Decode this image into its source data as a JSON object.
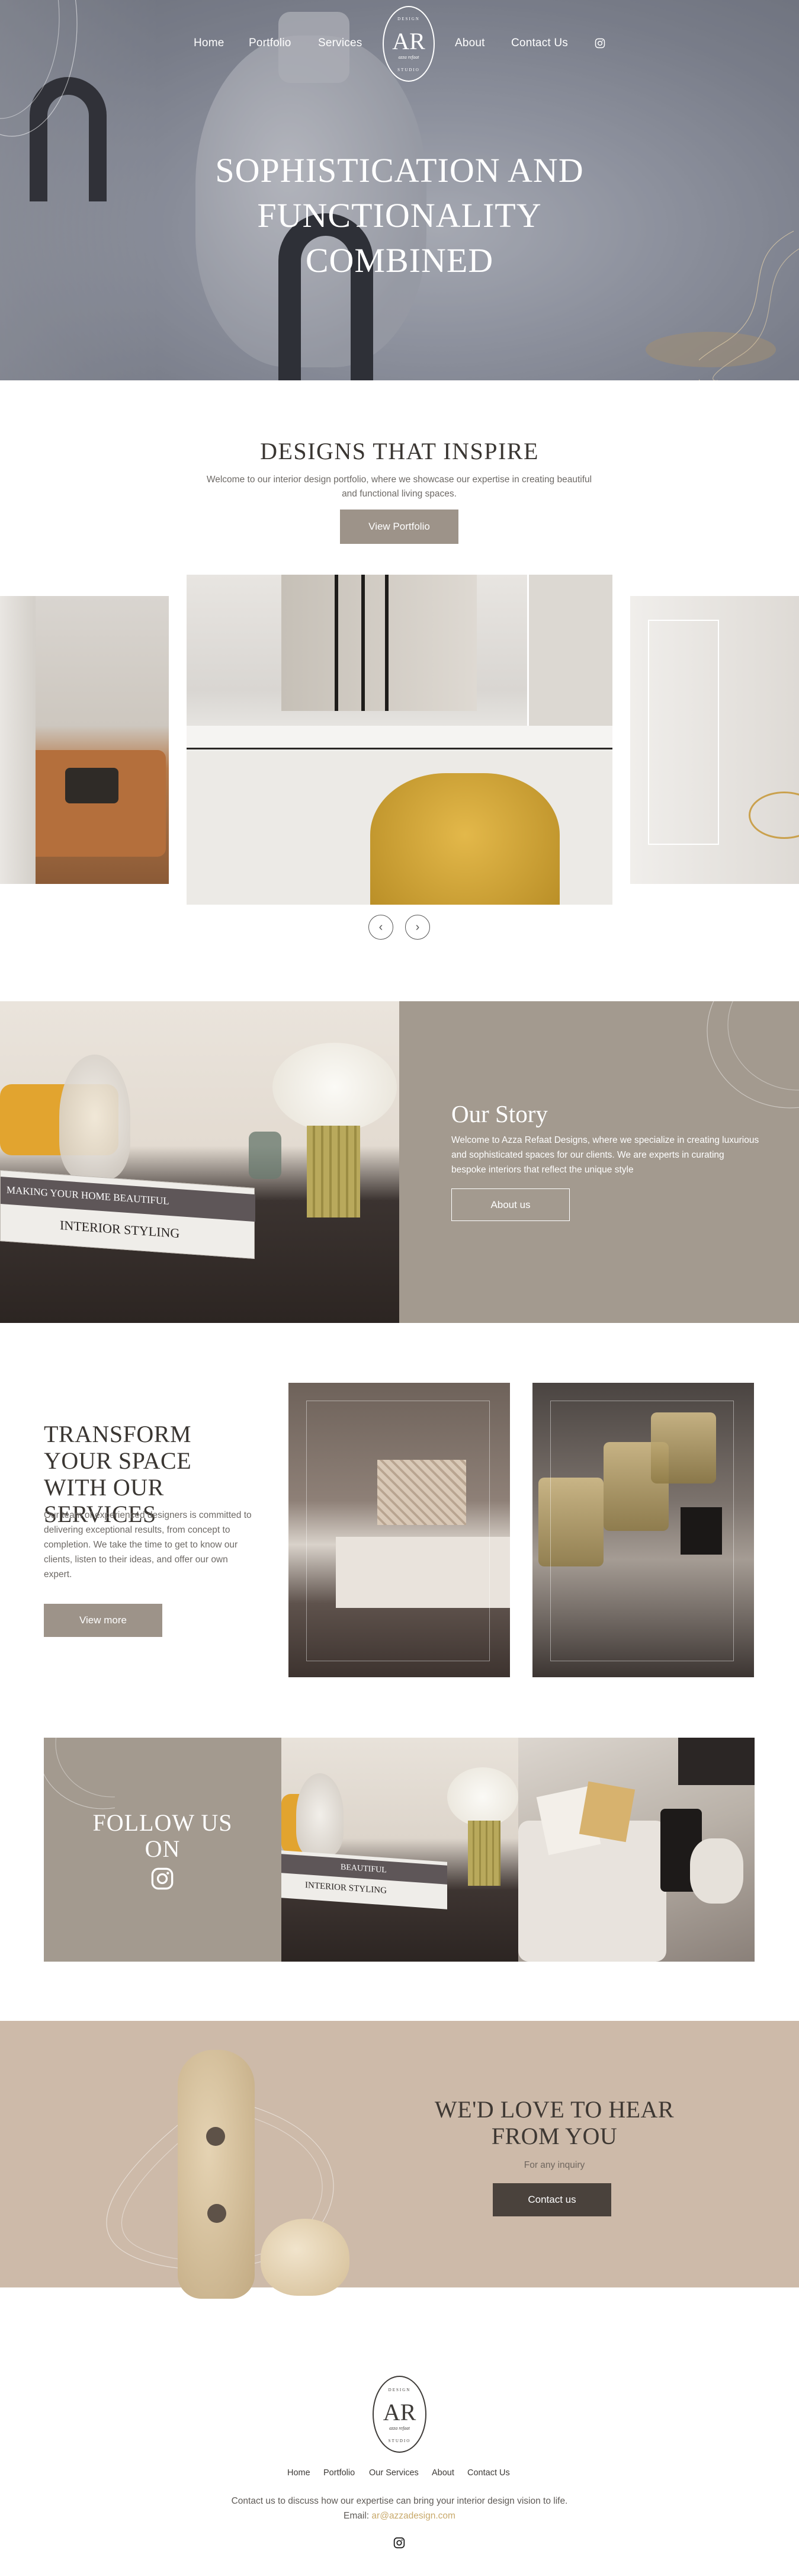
{
  "nav": {
    "home": "Home",
    "portfolio": "Portfolio",
    "services": "Services",
    "about": "About",
    "contact": "Contact Us"
  },
  "logo": {
    "monogram": "AR",
    "top_text": "DESIGN",
    "bottom_text": "STUDIO",
    "script_text": "azza refaat"
  },
  "hero": {
    "line1": "SOPHISTICATION AND",
    "line2": "FUNCTIONALITY",
    "line3": "COMBINED"
  },
  "inspire": {
    "title": "DESIGNS THAT INSPIRE",
    "text": "Welcome to our interior design portfolio, where we showcase our expertise in creating beautiful and functional living spaces.",
    "button": "View Portfolio"
  },
  "carousel": {
    "prev": "‹",
    "next": "›"
  },
  "story": {
    "title": "Our Story",
    "text": "Welcome to Azza Refaat Designs, where we specialize in creating luxurious and sophisticated spaces for our clients. We are experts in curating bespoke interiors that reflect the unique style",
    "button": "About us",
    "book1": "MAKING YOUR HOME BEAUTIFUL",
    "book2": "INTERIOR STYLING"
  },
  "transform": {
    "title": "TRANSFORM YOUR SPACE WITH OUR SERVICES",
    "text": "Our team of experienced designers is committed to delivering exceptional results, from concept to completion. We take the time to get to know our clients, listen to their ideas, and offer our own expert.",
    "button": "View more"
  },
  "follow": {
    "line1": "FOLLOW US",
    "line2": "ON",
    "book1": "BEAUTIFUL",
    "book2": "INTERIOR STYLING"
  },
  "contact": {
    "title": "WE'D LOVE TO HEAR FROM YOU",
    "sub": "For any inquiry",
    "button": "Contact us"
  },
  "footer": {
    "nav": [
      "Home",
      "Portfolio",
      "Our Services",
      "About",
      "Contact Us"
    ],
    "text": "Contact us to discuss how our expertise can bring your interior design vision to life.",
    "email_label": "Email:",
    "email": "ar@azzadesign.com"
  },
  "colors": {
    "taupe": "#a39a8f",
    "button": "#9d9389",
    "sand": "#cdbaa9",
    "dark_button": "#4a423c",
    "gold": "#c8a96b"
  },
  "icons": [
    "instagram-icon",
    "chevron-left-icon",
    "chevron-right-icon"
  ]
}
